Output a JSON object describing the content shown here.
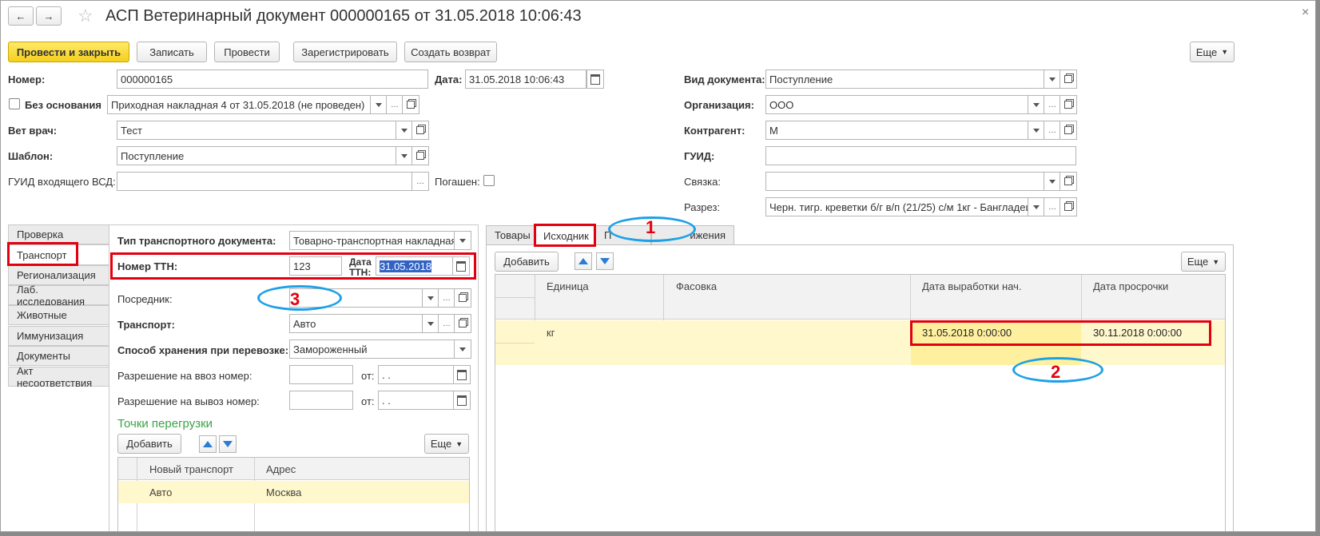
{
  "window": {
    "title": "АСП Ветеринарный документ 000000165 от 31.05.2018 10:06:43",
    "close": "×"
  },
  "toolbar": {
    "post_close": "Провести и закрыть",
    "save": "Записать",
    "post": "Провести",
    "register": "Зарегистрировать",
    "create_return": "Создать возврат",
    "more": "Еще"
  },
  "header": {
    "number_label": "Номер:",
    "number_value": "000000165",
    "date_label": "Дата:",
    "date_value": "31.05.2018 10:06:43",
    "no_basis_label": "Без основания",
    "basis_value": "Приходная накладная 4 от 31.05.2018 (не проведен)",
    "vet_label": "Вет врач:",
    "vet_value": "Тест",
    "template_label": "Шаблон:",
    "template_value": "Поступление",
    "guid_in_label": "ГУИД входящего ВСД:",
    "guid_in_value": "",
    "repaid_label": "Погашен:",
    "doc_type_label": "Вид документа:",
    "doc_type_value": "Поступление",
    "org_label": "Организация:",
    "org_value": "ООО",
    "contractor_label": "Контрагент:",
    "contractor_value": "М",
    "guid_label": "ГУИД:",
    "guid_value": "",
    "link_label": "Связка:",
    "link_value": "",
    "cut_label": "Разрез:",
    "cut_value": "Черн. тигр. креветки б/г в/п (21/25) с/м 1кг - Бангладеш"
  },
  "left_tabs": [
    "Проверка",
    "Транспорт",
    "Регионализация",
    "Лаб. исследования",
    "Животные",
    "Иммунизация",
    "Документы",
    "Акт несоответствия"
  ],
  "transport": {
    "doc_type_label": "Тип транспортного документа:",
    "doc_type_value": "Товарно-транспортная накладная",
    "ttn_label": "Номер ТТН:",
    "ttn_value": "123",
    "ttn_date_label": "Дата ТТН:",
    "ttn_date_value": "31.05.2018",
    "intermediary_label": "Посредник:",
    "intermediary_value": "",
    "transport_label": "Транспорт:",
    "transport_value": "Авто",
    "storage_label": "Способ хранения при перевозке:",
    "storage_value": "Замороженный",
    "import_label": "Разрешение на ввоз номер:",
    "export_label": "Разрешение на вывоз номер:",
    "from_label": "от:",
    "empty_date": " .  .",
    "reload_title": "Точки перегрузки",
    "add": "Добавить",
    "more": "Еще",
    "col_new_transport": "Новый транспорт",
    "col_address": "Адрес",
    "row_transport": "Авто",
    "row_address": "Москва"
  },
  "right_tabs": {
    "goods": "Товары",
    "source": "Исходник",
    "hidden_p": "П",
    "movements": "ижения"
  },
  "source_grid": {
    "add": "Добавить",
    "more": "Еще",
    "col_unit": "Единица",
    "col_pack": "Фасовка",
    "col_prod_start": "Дата выработки нач.",
    "col_expiry": "Дата просрочки",
    "row_unit": "кг",
    "row_pack": "",
    "row_prod_start": "31.05.2018 0:00:00",
    "row_expiry": "30.11.2018 0:00:00"
  },
  "annotations": {
    "n1": "1",
    "n2": "2",
    "n3": "3"
  },
  "colors": {
    "accent_yellow": "#f5cf1c",
    "highlight_red": "#e3000f",
    "ellipse_blue": "#1ea0e6",
    "row_selected": "#fff8cc",
    "section_green": "#3aa345"
  }
}
